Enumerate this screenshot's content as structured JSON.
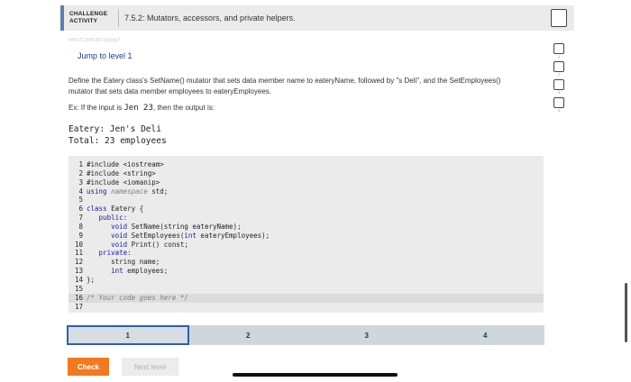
{
  "header": {
    "activity_label": "CHALLENGE ACTIVITY",
    "title": "7.5.2: Mutators, accessors, and private helpers."
  },
  "meta_id": "445572.3081952.qx3zqy7",
  "jump_link": "Jump to level 1",
  "level_indicators": [
    "1",
    "2",
    "3",
    "4"
  ],
  "description": "Define the Eatery class's SetName() mutator that sets data member name to eateryName, followed by \"s Deli\", and the SetEmployees() mutator that sets data member employees to eateryEmployees.",
  "example": {
    "prefix": "Ex: If the input is ",
    "input": "Jen 23",
    "suffix": ", then the output is:"
  },
  "output_lines": [
    "Eatery: Jen's Deli",
    "Total: 23 employees"
  ],
  "code_lines": [
    {
      "n": "1",
      "segments": [
        {
          "t": "#include <iostream>",
          "c": "src"
        }
      ]
    },
    {
      "n": "2",
      "segments": [
        {
          "t": "#include <string>",
          "c": "src"
        }
      ]
    },
    {
      "n": "3",
      "segments": [
        {
          "t": "#include <iomanip>",
          "c": "src"
        }
      ]
    },
    {
      "n": "4",
      "segments": [
        {
          "t": "using ",
          "c": "kw"
        },
        {
          "t": "namespace",
          "c": "cm"
        },
        {
          "t": " std;",
          "c": "src"
        }
      ]
    },
    {
      "n": "5",
      "segments": []
    },
    {
      "n": "6",
      "segments": [
        {
          "t": "class ",
          "c": "kw"
        },
        {
          "t": "Eatery {",
          "c": "src"
        }
      ]
    },
    {
      "n": "7",
      "segments": [
        {
          "t": "   public:",
          "c": "kw"
        }
      ]
    },
    {
      "n": "8",
      "segments": [
        {
          "t": "      void ",
          "c": "kw"
        },
        {
          "t": "SetName(string eateryName);",
          "c": "src"
        }
      ]
    },
    {
      "n": "9",
      "segments": [
        {
          "t": "      void ",
          "c": "kw"
        },
        {
          "t": "SetEmployees(",
          "c": "src"
        },
        {
          "t": "int",
          "c": "kw"
        },
        {
          "t": " eateryEmployees);",
          "c": "src"
        }
      ]
    },
    {
      "n": "10",
      "segments": [
        {
          "t": "      void ",
          "c": "kw"
        },
        {
          "t": "Print() const;",
          "c": "src"
        }
      ]
    },
    {
      "n": "11",
      "segments": [
        {
          "t": "   private:",
          "c": "kw"
        }
      ]
    },
    {
      "n": "12",
      "segments": [
        {
          "t": "      string name;",
          "c": "src"
        }
      ]
    },
    {
      "n": "13",
      "segments": [
        {
          "t": "      int",
          "c": "kw"
        },
        {
          "t": " employees;",
          "c": "src"
        }
      ]
    },
    {
      "n": "14",
      "segments": [
        {
          "t": "};",
          "c": "src"
        }
      ]
    },
    {
      "n": "15",
      "segments": []
    },
    {
      "n": "16",
      "segments": [
        {
          "t": "/* Your code goes here */",
          "c": "cm"
        }
      ],
      "highlight": true
    },
    {
      "n": "17",
      "segments": []
    }
  ],
  "level_tabs": [
    "1",
    "2",
    "3",
    "4"
  ],
  "active_level": "1",
  "buttons": {
    "check": "Check",
    "next_level": "Next level"
  },
  "colors": {
    "check_button": "#ef7a22",
    "active_tab_border": "#2f5fa8",
    "jump_link": "#1a3d8c"
  }
}
